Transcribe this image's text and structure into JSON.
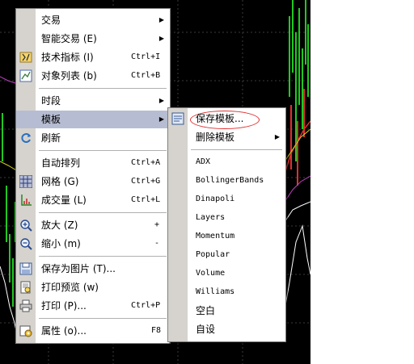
{
  "context_menu": {
    "items": [
      {
        "label": "交易",
        "shortcut": "",
        "icon": "",
        "submenu": true
      },
      {
        "label": "智能交易 (E)",
        "shortcut": "",
        "icon": "",
        "submenu": true
      },
      {
        "label": "技术指标 (I)",
        "shortcut": "Ctrl+I",
        "icon": "indicators-icon",
        "submenu": false
      },
      {
        "label": "对象列表 (b)",
        "shortcut": "Ctrl+B",
        "icon": "object-list-icon",
        "submenu": false
      },
      {
        "label": "时段",
        "shortcut": "",
        "icon": "",
        "submenu": true
      },
      {
        "label": "模板",
        "shortcut": "",
        "icon": "",
        "submenu": true,
        "selected": true
      },
      {
        "label": "刷新",
        "shortcut": "",
        "icon": "refresh-icon",
        "submenu": false
      },
      {
        "label": "自动排列",
        "shortcut": "Ctrl+A",
        "icon": "",
        "submenu": false
      },
      {
        "label": "网格 (G)",
        "shortcut": "Ctrl+G",
        "icon": "grid-icon",
        "submenu": false
      },
      {
        "label": "成交量 (L)",
        "shortcut": "Ctrl+L",
        "icon": "volumes-icon",
        "submenu": false
      },
      {
        "label": "放大 (Z)",
        "shortcut": "+",
        "icon": "zoom-in-icon",
        "submenu": false
      },
      {
        "label": "缩小 (m)",
        "shortcut": "-",
        "icon": "zoom-out-icon",
        "submenu": false
      },
      {
        "label": "保存为图片 (T)...",
        "shortcut": "",
        "icon": "save-picture-icon",
        "submenu": false
      },
      {
        "label": "打印预览 (w)",
        "shortcut": "",
        "icon": "print-preview-icon",
        "submenu": false
      },
      {
        "label": "打印 (P)...",
        "shortcut": "Ctrl+P",
        "icon": "print-icon",
        "submenu": false
      },
      {
        "label": "属性 (o)...",
        "shortcut": "F8",
        "icon": "properties-icon",
        "submenu": false
      }
    ]
  },
  "template_submenu": {
    "items": [
      {
        "label": "保存模板...",
        "icon": "save-template-icon",
        "highlighted_with_circle": true
      },
      {
        "label": "删除模板",
        "submenu": true
      },
      {
        "label": "ADX"
      },
      {
        "label": "BollingerBands"
      },
      {
        "label": "Dinapoli"
      },
      {
        "label": "Layers"
      },
      {
        "label": "Momentum"
      },
      {
        "label": "Popular"
      },
      {
        "label": "Volume"
      },
      {
        "label": "Williams"
      },
      {
        "label": "空白"
      },
      {
        "label": "自设"
      }
    ]
  },
  "colors": {
    "chart_background": "#000000",
    "menu_gutter": "#d6d3ce",
    "selected_item": "#b6bdd2",
    "annotation_circle": "#e23030"
  }
}
